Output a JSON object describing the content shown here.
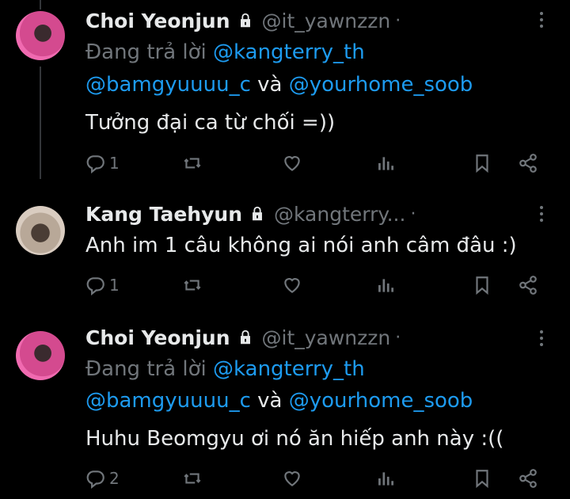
{
  "tweets": [
    {
      "name": "Choi Yeonjun",
      "handle": "@it_yawnzzn",
      "dot": "·",
      "reply_prefix": "Đang trả lời",
      "reply_to_1": "@kangterry_th",
      "reply_to_2": "@bamgyuuuu_c",
      "reply_and": "và",
      "reply_to_3": "@yourhome_soob",
      "text": "Tưởng đại ca từ chối =))",
      "reply_count": "1",
      "retweet_count": "",
      "like_count": "",
      "view_count": ""
    },
    {
      "name": "Kang Taehyun",
      "handle": "@kangterry...",
      "dot": "·",
      "text": "Anh im 1 câu không ai nói anh câm đâu :)",
      "reply_count": "1",
      "retweet_count": "",
      "like_count": "",
      "view_count": ""
    },
    {
      "name": "Choi Yeonjun",
      "handle": "@it_yawnzzn",
      "dot": "·",
      "reply_prefix": "Đang trả lời",
      "reply_to_1": "@kangterry_th",
      "reply_to_2": "@bamgyuuuu_c",
      "reply_and": "và",
      "reply_to_3": "@yourhome_soob",
      "text": "Huhu Beomgyu ơi nó ăn hiếp anh này :((",
      "reply_count": "2",
      "retweet_count": "",
      "like_count": "",
      "view_count": ""
    }
  ],
  "colors": {
    "background": "#000000",
    "text": "#e7e9ea",
    "muted": "#71767b",
    "mention": "#1d9bf0"
  },
  "icons": [
    "lock-icon",
    "more-icon",
    "reply-icon",
    "retweet-icon",
    "like-icon",
    "views-icon",
    "bookmark-icon",
    "share-icon"
  ]
}
